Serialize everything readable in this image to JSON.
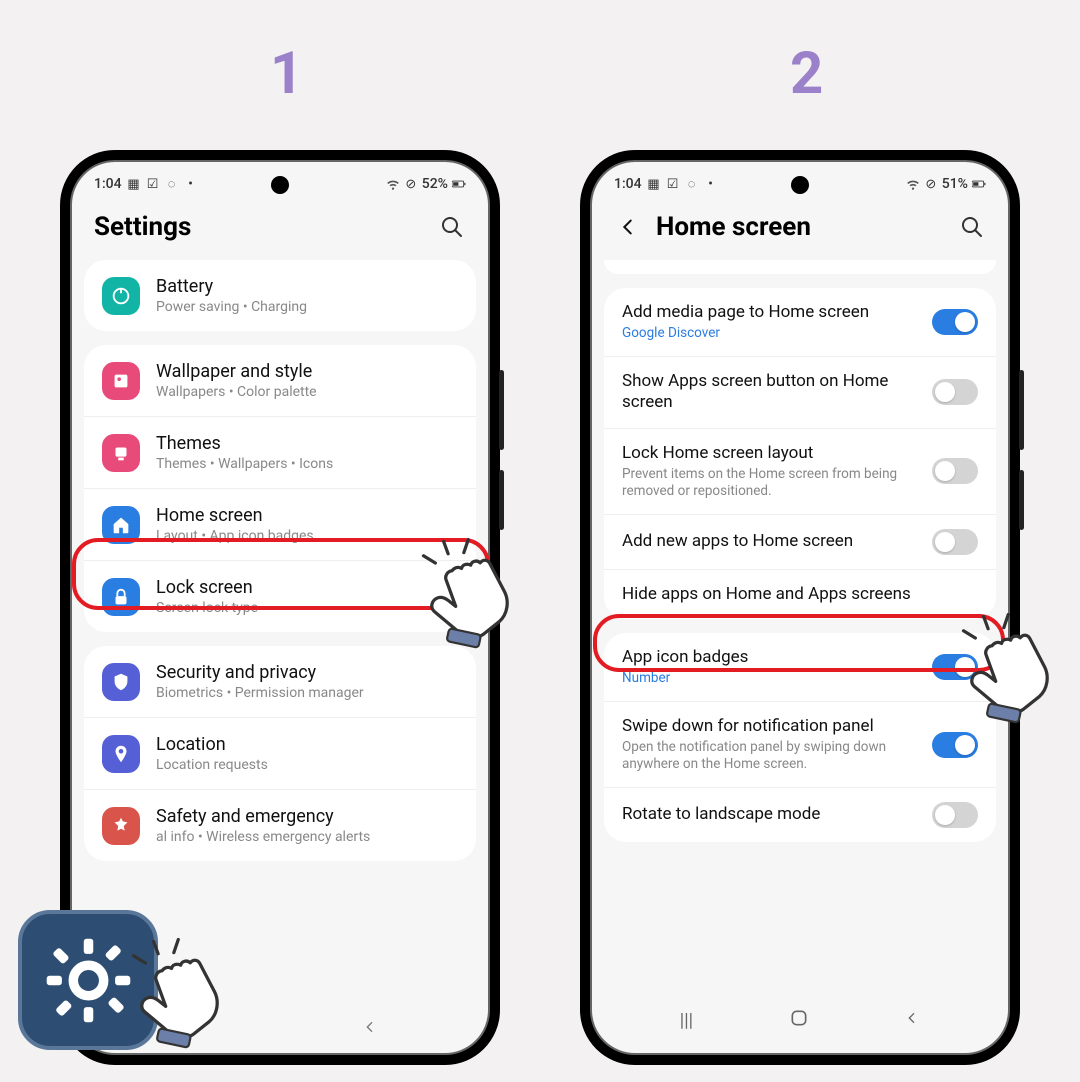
{
  "steps": {
    "s1": "1",
    "s2": "2"
  },
  "status": {
    "time1": "1:04",
    "time2": "1:04",
    "batt1": "52%",
    "batt2": "51%"
  },
  "phone1": {
    "title": "Settings",
    "battery_title": "Battery",
    "battery_sub": "Power saving  •  Charging",
    "wallpaper_title": "Wallpaper and style",
    "wallpaper_sub": "Wallpapers  •  Color palette",
    "themes_title": "Themes",
    "themes_sub": "Themes  •  Wallpapers  •  Icons",
    "home_title": "Home screen",
    "home_sub": "Layout  •  App icon badges",
    "lock_title": "Lock screen",
    "lock_sub": "Screen lock type",
    "security_title": "Security and privacy",
    "security_sub": "Biometrics  •  Permission manager",
    "location_title": "Location",
    "location_sub": "Location requests",
    "safety_title": "Safety and emergency",
    "safety_sub": "al info  •  Wireless emergency alerts"
  },
  "phone2": {
    "title": "Home screen",
    "media_title": "Add media page to Home screen",
    "media_sub": "Google Discover",
    "showapps_title": "Show Apps screen button on Home screen",
    "locklayout_title": "Lock Home screen layout",
    "locklayout_sub": "Prevent items on the Home screen from being removed or repositioned.",
    "addnew_title": "Add new apps to Home screen",
    "hide_title": "Hide apps on Home and Apps screens",
    "badges_title": "App icon badges",
    "badges_sub": "Number",
    "swipe_title": "Swipe down for notification panel",
    "swipe_sub": "Open the notification panel by swiping down anywhere on the Home screen.",
    "rotate_title": "Rotate to landscape mode"
  },
  "colors": {
    "battery": "#12b5a5",
    "wallpaper": "#e84a7a",
    "themes": "#e84a7a",
    "home": "#2a7de1",
    "lock": "#2a7de1",
    "security": "#5560d6",
    "location": "#5560d6",
    "safety": "#d9554b"
  }
}
